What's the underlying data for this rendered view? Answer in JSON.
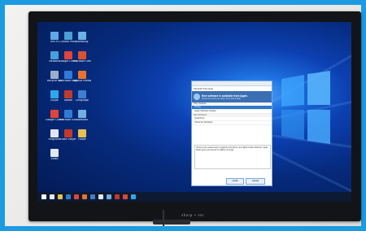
{
  "desktop_icons": [
    {
      "label": "This PC",
      "color": "#5fa8e8"
    },
    {
      "label": "Control Panel",
      "color": "#4a9fd8"
    },
    {
      "label": "Samsung",
      "color": "#6ab0e6"
    },
    {
      "label": "Network",
      "color": "#4a9fd8"
    },
    {
      "label": "Google Chrome",
      "color": "#e0443a"
    },
    {
      "label": "Microsoft Office 2013",
      "color": "#d9532c"
    },
    {
      "label": "Recycle Bin",
      "color": "#9ab0c8"
    },
    {
      "label": "Microsoft Edge",
      "color": "#2f7bd6"
    },
    {
      "label": "Mozilla Firefox",
      "color": "#e8742c"
    },
    {
      "label": "Skype",
      "color": "#2fa8e8"
    },
    {
      "label": "Adobe",
      "color": "#c0392b"
    },
    {
      "label": "Language",
      "color": "#3f7fcf"
    },
    {
      "label": "Google Chrome",
      "color": "#e0443a"
    },
    {
      "label": "Microsoft Education",
      "color": "#2f7bd6"
    },
    {
      "label": "Notepad",
      "color": "#70b0e0"
    },
    {
      "label": "Programs",
      "color": "#dfe8f0"
    },
    {
      "label": "Flash Player",
      "color": "#c0392b"
    },
    {
      "label": "Folder",
      "color": "#e8c050"
    },
    {
      "label": "Video",
      "color": "#dfe8f0"
    }
  ],
  "dialog": {
    "menu": "File  Edit  Tools  Help",
    "title": "New software is available from Apple.",
    "subtitle": "Select the items you want, then click Install.",
    "sections": [
      "New Updates",
      "New Software"
    ],
    "rows": [
      {
        "name": "iTunes",
        "selected": true
      },
      {
        "name": "Apple Software Update",
        "selected": false
      },
      {
        "name": "QuickTime",
        "selected": false
      },
      {
        "name": "iCloud for Windows",
        "selected": false
      }
    ],
    "description": "iTunes is the easiest way to organize and add to your digital media collection. Apple Music gives you access to millions of songs.",
    "install_label": "Install",
    "cancel_label": "Cancel"
  },
  "brand": "sharp • rec",
  "taskbar_colors": [
    "#ffffff",
    "#dfe8f0",
    "#e8c050",
    "#2f7bd6",
    "#e0443a",
    "#e8742c",
    "#3f7fcf",
    "#dfe8f0",
    "#70b0e0",
    "#c0392b",
    "#e0443a",
    "#2fa8e8"
  ]
}
